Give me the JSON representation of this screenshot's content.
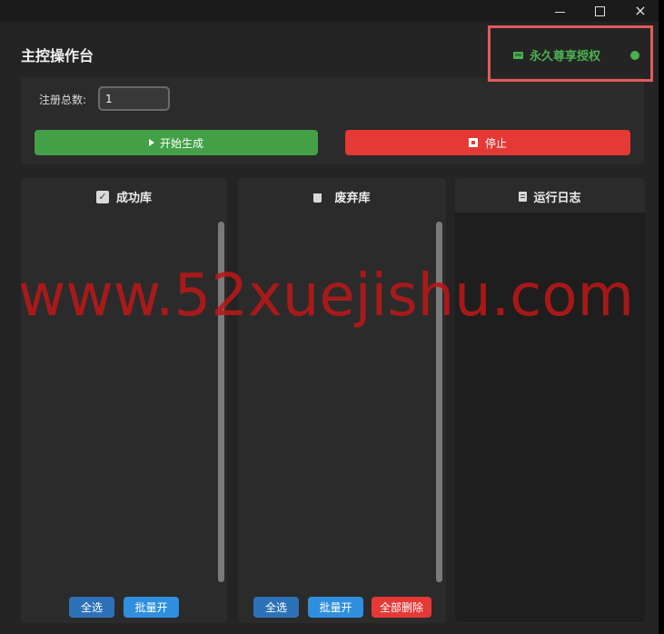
{
  "window": {
    "controls": {
      "minimize": "minimize-icon",
      "maximize": "maximize-icon",
      "close": "×"
    }
  },
  "header": {
    "title": "主控操作台",
    "license_text": "永久尊享授权",
    "license_color": "#4caf50",
    "status_color": "#4caf50"
  },
  "controls": {
    "reg_label": "注册总数:",
    "reg_value": "1",
    "start_label": "开始生成",
    "stop_label": "停止",
    "start_color": "#43a047",
    "stop_color": "#e53935"
  },
  "panels": {
    "success": {
      "title": "成功库",
      "icon": "checkbox-icon",
      "buttons": [
        "全选",
        "批量开"
      ]
    },
    "discard": {
      "title": "废弃库",
      "icon": "trash-icon",
      "buttons": [
        "全选",
        "批量开",
        "全部删除"
      ]
    },
    "log": {
      "title": "运行日志",
      "icon": "log-icon"
    }
  },
  "watermark": "www.52xuejishu.com"
}
